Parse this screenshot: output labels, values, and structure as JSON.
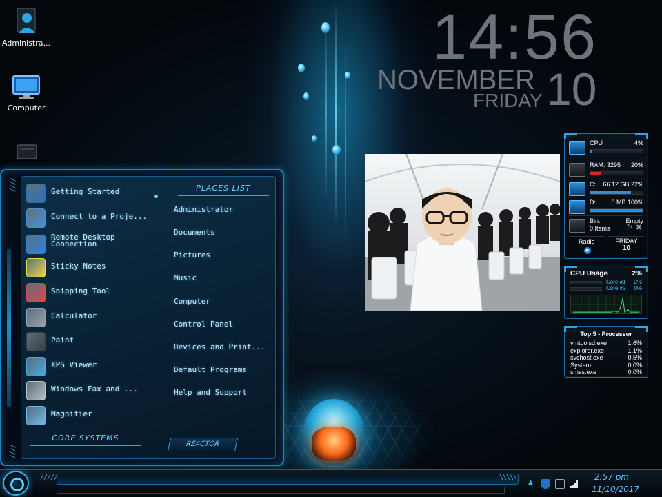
{
  "desktop": {
    "icons": [
      {
        "label": "Administra...",
        "icon": "user-folder-icon"
      },
      {
        "label": "Computer",
        "icon": "computer-monitor-icon"
      },
      {
        "label": "",
        "icon": "drive-icon"
      }
    ]
  },
  "clock": {
    "time": "14:56",
    "month": "NOVEMBER",
    "weekday": "FRIDAY",
    "date": "10"
  },
  "system_meter": {
    "cpu": {
      "label": "CPU",
      "value": "4%",
      "fill": 0.04
    },
    "ram": {
      "label": "RAM: 3295",
      "value": "20%",
      "fill": 0.2
    },
    "drive_c": {
      "label": "C:",
      "value": "66.12 GB 22%",
      "fill": 0.78
    },
    "drive_d": {
      "label": "D:",
      "value": "0 MB 100%",
      "fill": 1.0
    },
    "bin": {
      "label": "Bin:",
      "status": "Empty",
      "items": "0 Items"
    },
    "radio": {
      "label": "Radio"
    },
    "day": {
      "weekday": "FRIDAY",
      "date": "10"
    }
  },
  "cpu_usage": {
    "title": "CPU Usage",
    "total": "2%",
    "cores": [
      {
        "label": "Core #1",
        "value": "2%"
      },
      {
        "label": "Core #2",
        "value": "0%"
      }
    ]
  },
  "top_processes": {
    "title": "Top 5 - Processor",
    "rows": [
      {
        "name": "vmtoolsd.exe",
        "value": "1.6%"
      },
      {
        "name": "explorer.exe",
        "value": "1.1%"
      },
      {
        "name": "svchost.exe",
        "value": "0.5%"
      },
      {
        "name": "System",
        "value": "0.0%"
      },
      {
        "name": "smss.exe",
        "value": "0.0%"
      }
    ]
  },
  "start_menu": {
    "programs": [
      {
        "label": "Getting Started",
        "icon": "getting-started-icon",
        "color": "#2a6fb0"
      },
      {
        "label": "Connect to a Proje...",
        "icon": "projector-icon",
        "color": "#4a90d0"
      },
      {
        "label": "Remote Desktop Connection",
        "icon": "remote-desktop-icon",
        "color": "#2a84d8"
      },
      {
        "label": "Sticky Notes",
        "icon": "sticky-notes-icon",
        "color": "#e8d64a"
      },
      {
        "label": "Snipping Tool",
        "icon": "snipping-tool-icon",
        "color": "#d84a4a"
      },
      {
        "label": "Calculator",
        "icon": "calculator-icon",
        "color": "#9aa3ab"
      },
      {
        "label": "Paint",
        "icon": "paint-icon",
        "color": "#3a3f44"
      },
      {
        "label": "XPS Viewer",
        "icon": "xps-viewer-icon",
        "color": "#4aa8e0"
      },
      {
        "label": "Windows Fax and ...",
        "icon": "fax-icon",
        "color": "#b8c0c8"
      },
      {
        "label": "Magnifier",
        "icon": "magnifier-icon",
        "color": "#6fb8e8"
      }
    ],
    "places_title": "PLACES LIST",
    "places": [
      "Administrator",
      "Documents",
      "Pictures",
      "Music",
      "Computer",
      "Control Panel",
      "Devices and Print...",
      "Default Programs",
      "Help and Support"
    ],
    "core_title": "CORE SYSTEMS",
    "reactor_label": "REACTOR"
  },
  "taskbar": {
    "time": "2:57 pm",
    "date": "11/10/2017"
  },
  "colors": {
    "accent": "#29a9e0",
    "ram_bar": "#d8262a",
    "disk_bar": "#2b8fe0"
  }
}
